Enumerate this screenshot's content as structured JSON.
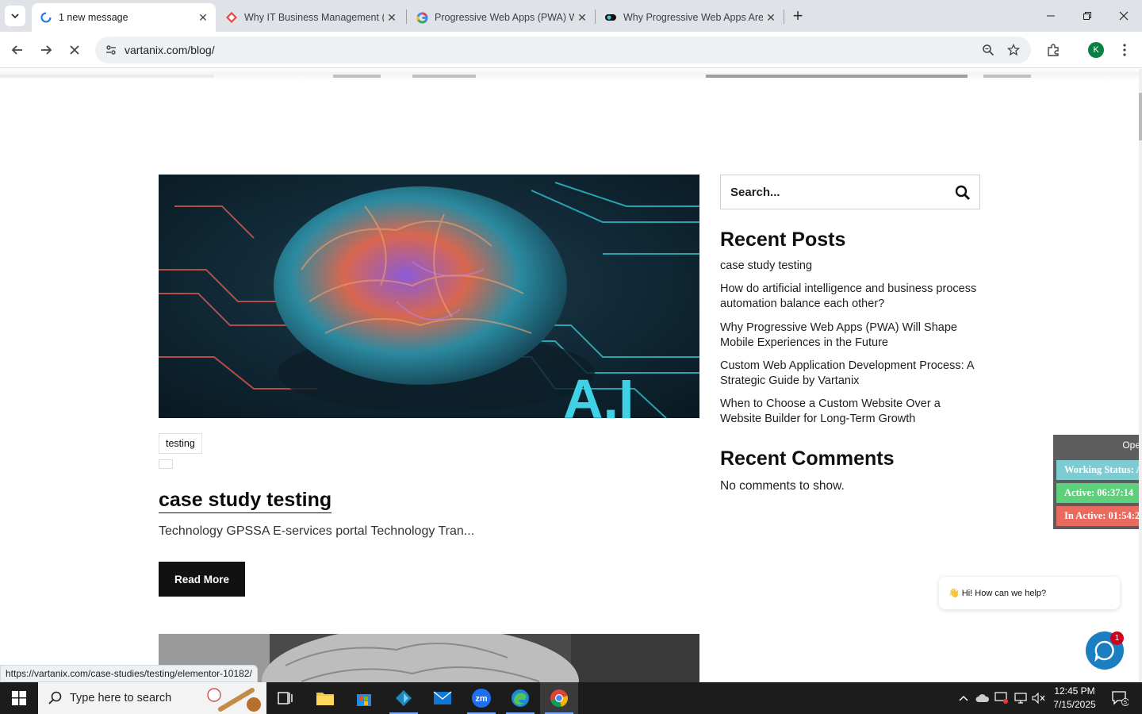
{
  "browser": {
    "tabs": [
      {
        "title": "1 new message",
        "active": true
      },
      {
        "title": "Why IT Business Management (",
        "active": false
      },
      {
        "title": "Progressive Web Apps (PWA) W",
        "active": false
      },
      {
        "title": "Why Progressive Web Apps Are",
        "active": false
      }
    ],
    "url": "vartanix.com/blog/",
    "profile_initial": "K",
    "status_url": "https://vartanix.com/case-studies/testing/elementor-10182/"
  },
  "post": {
    "tag": "testing",
    "title": "case study testing",
    "excerpt": "Technology GPSSA E-services portal Technology Tran...",
    "read_more": "Read More",
    "image_text": "A.I"
  },
  "sidebar": {
    "search_placeholder": "Search...",
    "recent_posts_title": "Recent Posts",
    "recent_posts": [
      "case study testing",
      "How do artificial intelligence and business process automation balance each other?",
      "Why Progressive Web Apps (PWA) Will Shape Mobile Experiences in the Future",
      "Custom Web Application Development Process: A Strategic Guide by Vartanix",
      "When to Choose a Custom Website Over a Website Builder for Long-Term Growth"
    ],
    "recent_comments_title": "Recent Comments",
    "no_comments": "No comments to show."
  },
  "tracker": {
    "header": "Ope",
    "working_status": "Working Status: A",
    "active": "Active: 06:37:14",
    "inactive": "In Active: 01:54:2"
  },
  "chat": {
    "greeting": "👋 Hi! How can we help?",
    "badge": "1"
  },
  "taskbar": {
    "search_placeholder": "Type here to search",
    "time": "12:45 PM",
    "date": "7/15/2025",
    "notification_count": "5"
  },
  "colors": {
    "tracker_status": "#7ecbd1",
    "tracker_active": "#5cd07a",
    "tracker_inactive": "#e96a5e",
    "chat_button": "#1a7fc1"
  }
}
